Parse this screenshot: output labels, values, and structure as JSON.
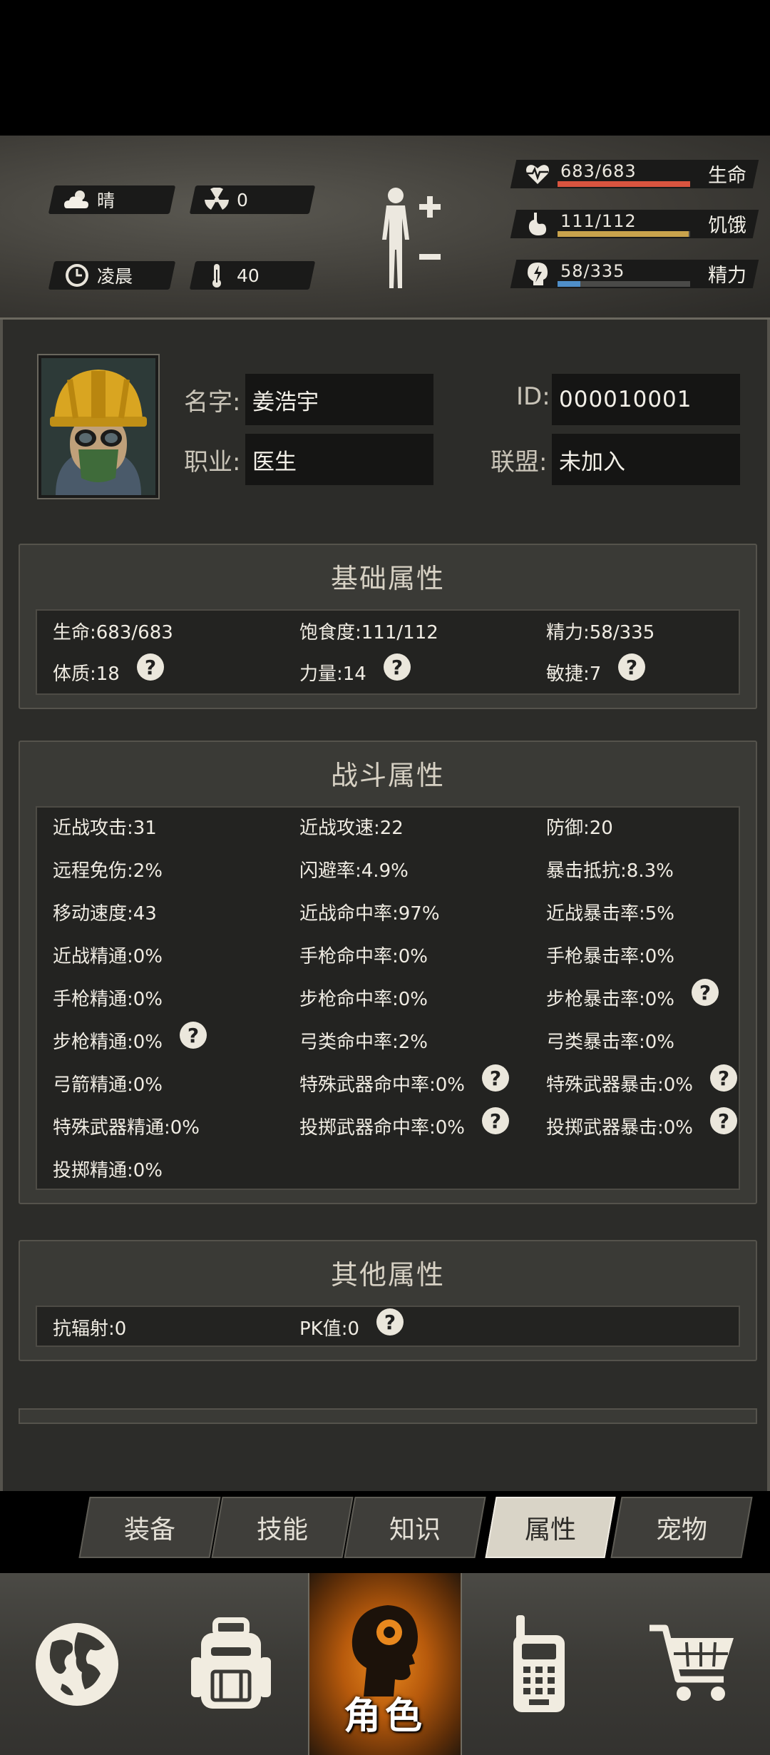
{
  "status": {
    "weather": {
      "label": "晴",
      "icon": "cloud-icon"
    },
    "radiation": {
      "value": "0",
      "icon": "radiation-icon"
    },
    "time": {
      "label": "凌晨",
      "icon": "clock-icon"
    },
    "temperature": {
      "value": "40",
      "icon": "thermometer-icon"
    },
    "health": {
      "value": "683/683",
      "label": "生命",
      "fraction": 1.0,
      "color": "#d9543f"
    },
    "hunger": {
      "value": "111/112",
      "label": "饥饿",
      "fraction": 0.991,
      "color": "#c9a34c"
    },
    "energy": {
      "value": "58/335",
      "label": "精力",
      "fraction": 0.173,
      "color": "#4f8fc9"
    }
  },
  "profile": {
    "name_label": "名字:",
    "name": "姜浩宇",
    "job_label": "职业:",
    "job": "医生",
    "id_label": "ID:",
    "id": "000010001",
    "alliance_label": "联盟:",
    "alliance": "未加入"
  },
  "basic": {
    "title": "基础属性",
    "items": [
      {
        "text": "生命:683/683"
      },
      {
        "text": "饱食度:111/112"
      },
      {
        "text": "精力:58/335"
      },
      {
        "text": "体质:18"
      },
      {
        "text": "力量:14"
      },
      {
        "text": "敏捷:7"
      }
    ]
  },
  "combat": {
    "title": "战斗属性",
    "items": [
      {
        "text": "近战攻击:31"
      },
      {
        "text": "近战攻速:22"
      },
      {
        "text": "防御:20"
      },
      {
        "text": "远程免伤:2%"
      },
      {
        "text": "闪避率:4.9%"
      },
      {
        "text": "暴击抵抗:8.3%"
      },
      {
        "text": "移动速度:43"
      },
      {
        "text": "近战命中率:97%"
      },
      {
        "text": "近战暴击率:5%"
      },
      {
        "text": "近战精通:0%"
      },
      {
        "text": "手枪命中率:0%"
      },
      {
        "text": "手枪暴击率:0%"
      },
      {
        "text": "手枪精通:0%"
      },
      {
        "text": "步枪命中率:0%"
      },
      {
        "text": "步枪暴击率:0%"
      },
      {
        "text": "步枪精通:0%"
      },
      {
        "text": "弓类命中率:2%"
      },
      {
        "text": "弓类暴击率:0%"
      },
      {
        "text": "弓箭精通:0%"
      },
      {
        "text": "特殊武器命中率:0%"
      },
      {
        "text": "特殊武器暴击:0%"
      },
      {
        "text": "特殊武器精通:0%"
      },
      {
        "text": "投掷武器命中率:0%"
      },
      {
        "text": "投掷武器暴击:0%"
      },
      {
        "text": "投掷精通:0%"
      }
    ]
  },
  "other": {
    "title": "其他属性",
    "items": [
      {
        "text": "抗辐射:0"
      },
      {
        "text": "PK值:0"
      }
    ]
  },
  "help_glyph": "?",
  "tabs": [
    "装备",
    "技能",
    "知识",
    "属性",
    "宠物"
  ],
  "active_tab": "属性",
  "nav": {
    "items": [
      {
        "icon": "globe-icon"
      },
      {
        "icon": "backpack-icon"
      },
      {
        "icon": "head-icon",
        "label": "角色"
      },
      {
        "icon": "walkie-talkie-icon"
      },
      {
        "icon": "cart-icon"
      }
    ]
  }
}
